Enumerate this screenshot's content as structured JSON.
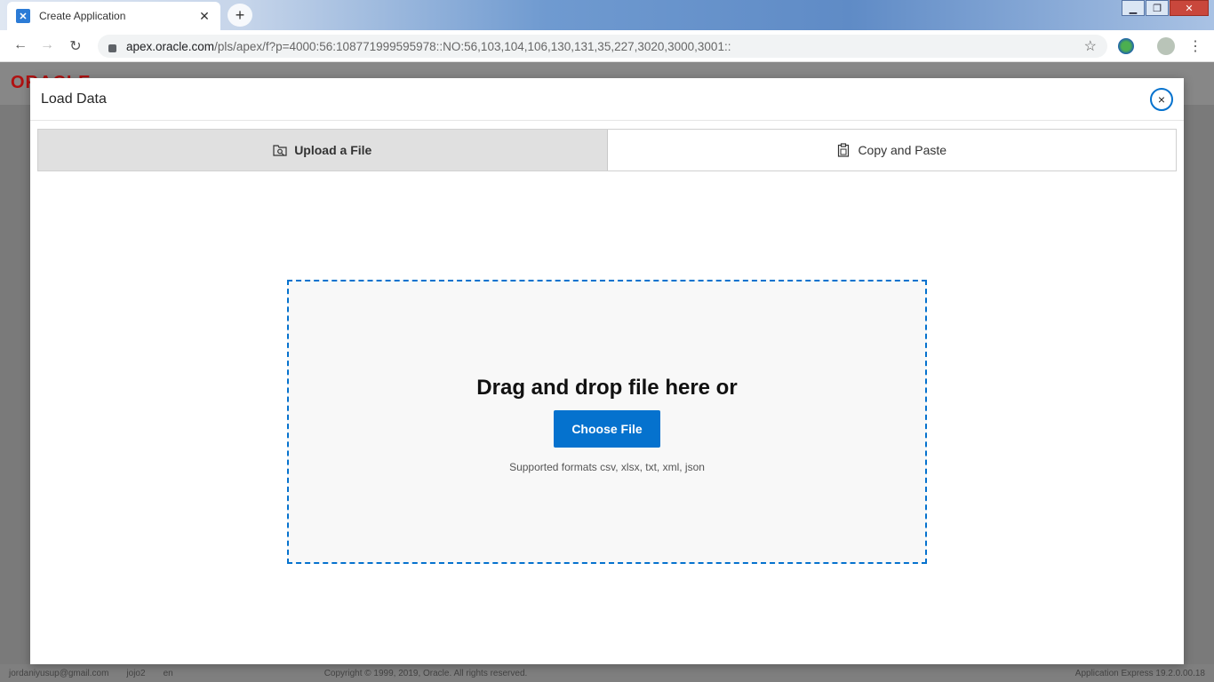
{
  "browser": {
    "tab_title": "Create Application",
    "url_host": "apex.oracle.com",
    "url_path": "/pls/apex/f?p=4000:56:108771999595978::NO:56,103,104,106,130,131,35,227,3020,3000,3001::"
  },
  "apex": {
    "logo": "ORACLE",
    "footer": {
      "user": "jordaniyusup@gmail.com",
      "workspace": "jojo2",
      "language": "en",
      "copyright": "Copyright © 1999, 2019, Oracle. All rights reserved.",
      "version": "Application Express 19.2.0.00.18"
    }
  },
  "dialog": {
    "title": "Load Data",
    "close_symbol": "×",
    "tabs": [
      {
        "label": "Upload a File",
        "icon": "upload-file-icon",
        "active": true
      },
      {
        "label": "Copy and Paste",
        "icon": "clipboard-icon",
        "active": false
      }
    ],
    "dropzone": {
      "heading": "Drag and drop file here or",
      "button_label": "Choose File",
      "formats": "Supported formats csv, xlsx, txt, xml, json"
    }
  },
  "colors": {
    "accent": "#0572ce",
    "oracle_red": "#b01111"
  }
}
